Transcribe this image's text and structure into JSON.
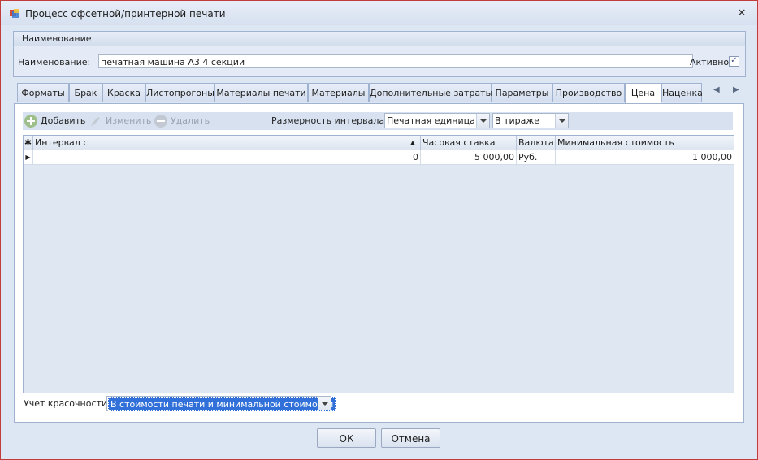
{
  "window": {
    "title": "Процесс офсетной/принтерной печати",
    "close_glyph": "✕"
  },
  "group": {
    "caption": "Наименование",
    "name_label": "Наименование:",
    "name_value": "печатная машина А3 4 секции",
    "active_label": "Активно",
    "active_checked": true
  },
  "tabs": [
    "Форматы",
    "Брак",
    "Краска",
    "Листопрогоны",
    "Материалы печати",
    "Материалы",
    "Дополнительные затраты",
    "Параметры",
    "Производство",
    "Цена",
    "Наценка"
  ],
  "active_tab": "Цена",
  "toolbar": {
    "add_label": "Добавить",
    "edit_label": "Изменить",
    "delete_label": "Удалить",
    "interval_label": "Размерность интервала:",
    "unit_value": "Печатная единица",
    "mode_value": "В тираже"
  },
  "grid": {
    "columns": [
      "Интервал с",
      "Часовая ставка",
      "Валюта",
      "Минимальная стоимость"
    ],
    "rows": [
      {
        "interval_from": "0",
        "hourly_rate": "5 000,00",
        "currency": "Руб.",
        "min_cost": "1 000,00"
      }
    ]
  },
  "color_accounting": {
    "label": "Учет красочности:",
    "value": "В стоимости печати и минимальной стоимости"
  },
  "buttons": {
    "ok": "ОК",
    "cancel": "Отмена"
  },
  "colors": {
    "window_border": "#c23c3c",
    "selection": "#3070d8",
    "add_icon": "#9fbf8a"
  }
}
